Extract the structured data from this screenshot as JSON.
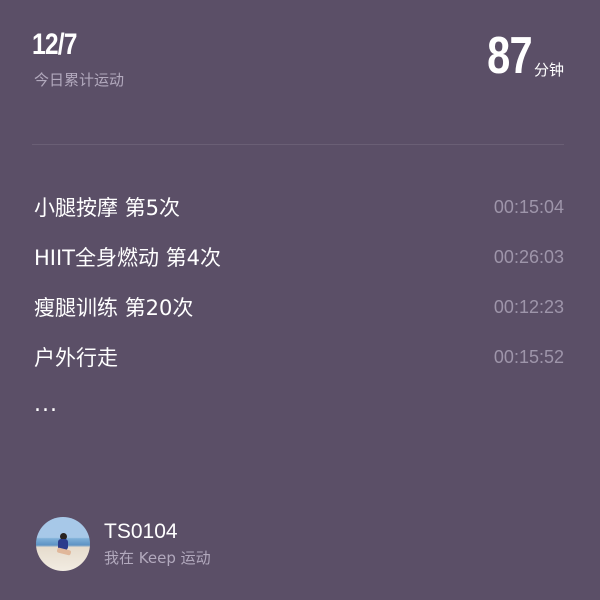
{
  "header": {
    "date": "12/7",
    "subtitle": "今日累计运动",
    "total_minutes": "87",
    "minutes_unit": "分钟"
  },
  "activities": [
    {
      "name": "小腿按摩 第5次",
      "duration": "00:15:04"
    },
    {
      "name": "HIIT全身燃动 第4次",
      "duration": "00:26:03"
    },
    {
      "name": "瘦腿训练 第20次",
      "duration": "00:12:23"
    },
    {
      "name": "户外行走",
      "duration": "00:15:52"
    }
  ],
  "more_indicator": "...",
  "user": {
    "name": "TS0104",
    "caption": "我在 Keep 运动"
  },
  "colors": {
    "background": "#5b4f67",
    "primary_text": "#ffffff",
    "secondary_text": "#b2a9bd",
    "time_text": "#9e95aa"
  }
}
